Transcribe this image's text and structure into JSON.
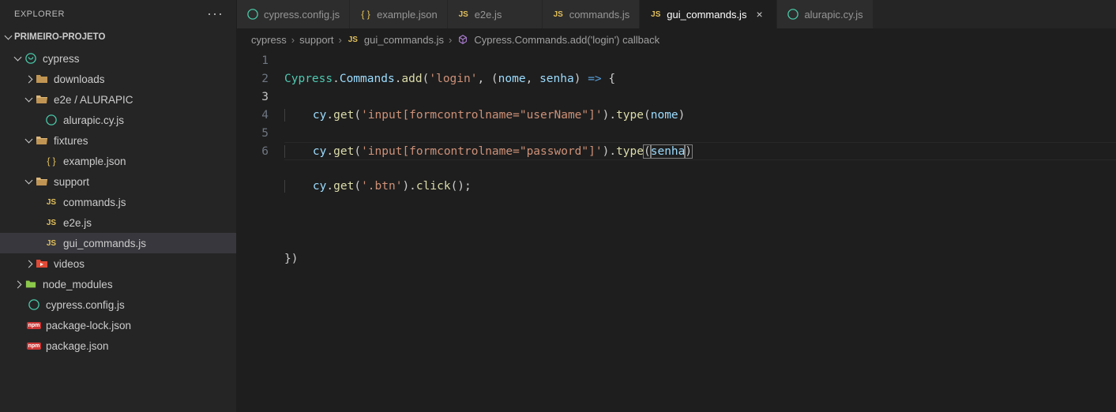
{
  "explorer": {
    "title": "EXPLORER"
  },
  "project": {
    "name": "PRIMEIRO-PROJETO"
  },
  "tree": {
    "cypress": "cypress",
    "downloads": "downloads",
    "e2e": "e2e / ALURAPIC",
    "alurapic": "alurapic.cy.js",
    "fixtures": "fixtures",
    "example": "example.json",
    "support": "support",
    "commands": "commands.js",
    "e2ejs": "e2e.js",
    "guicommands": "gui_commands.js",
    "videos": "videos",
    "nodemodules": "node_modules",
    "cypressconfig": "cypress.config.js",
    "packagelock": "package-lock.json",
    "packagejson": "package.json"
  },
  "tabs": [
    {
      "label": "cypress.config.js",
      "icon": "cypress",
      "active": false
    },
    {
      "label": "example.json",
      "icon": "json",
      "active": false
    },
    {
      "label": "e2e.js",
      "icon": "js",
      "active": false
    },
    {
      "label": "commands.js",
      "icon": "js",
      "active": false
    },
    {
      "label": "gui_commands.js",
      "icon": "js",
      "active": true
    },
    {
      "label": "alurapic.cy.js",
      "icon": "cypress",
      "active": false
    }
  ],
  "breadcrumb": {
    "p1": "cypress",
    "p2": "support",
    "p3": "gui_commands.js",
    "p4": "Cypress.Commands.add('login') callback"
  },
  "code": {
    "lines": [
      "1",
      "2",
      "3",
      "4",
      "5",
      "6"
    ],
    "activeLine": 3,
    "tokens": {
      "l1_cypress": "Cypress",
      "l1_commands": "Commands",
      "l1_add": "add",
      "l1_login": "'login'",
      "l1_nome": "nome",
      "l1_senha": "senha",
      "l2_cy": "cy",
      "l2_get": "get",
      "l2_sel": "'input[formcontrolname=\"userName\"]'",
      "l2_type": "type",
      "l2_nome": "nome",
      "l3_cy": "cy",
      "l3_get": "get",
      "l3_sel": "'input[formcontrolname=\"password\"]'",
      "l3_type": "type",
      "l3_senha": "senha",
      "l4_cy": "cy",
      "l4_get": "get",
      "l4_sel": "'.btn'",
      "l4_click": "click"
    }
  }
}
